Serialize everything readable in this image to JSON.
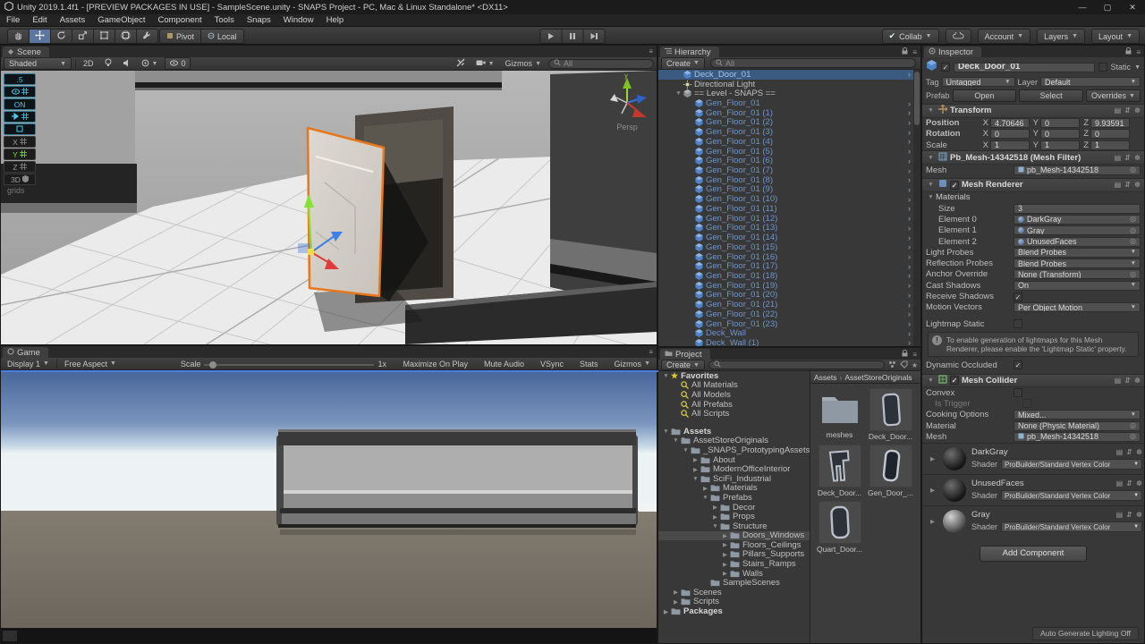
{
  "window": {
    "title": "Unity 2019.1.4f1 - [PREVIEW PACKAGES IN USE] - SampleScene.unity - SNAPS Project - PC, Mac & Linux Standalone* <DX11>",
    "menu_items": [
      "File",
      "Edit",
      "Assets",
      "GameObject",
      "Component",
      "Tools",
      "Snaps",
      "Window",
      "Help"
    ],
    "minimize": "—",
    "maximize": "▢",
    "close": "✕"
  },
  "toolbar": {
    "tools": [
      "hand-tool",
      "move-tool",
      "rotate-tool",
      "scale-tool",
      "rect-tool",
      "transform-tool",
      "custom-tool"
    ],
    "active_tool": "move-tool",
    "pivot_label": "Pivot",
    "local_label": "Local",
    "collab_label": "Collab",
    "account_label": "Account",
    "layers_label": "Layers",
    "layout_label": "Layout"
  },
  "scene_panel": {
    "tab": "Scene",
    "draw_mode": "Shaded",
    "mode_2d": "2D",
    "visibility_count": "0",
    "gizmos_label": "Gizmos",
    "search_placeholder": "All",
    "persp_label": "Persp",
    "progrids": {
      "snap_value": ".5",
      "on_label": "ON",
      "x": "X",
      "y": "Y",
      "z": "Z",
      "three_d": "3D",
      "grids_label": "grids"
    }
  },
  "game_panel": {
    "tab": "Game",
    "display": "Display 1",
    "aspect": "Free Aspect",
    "scale_label": "Scale",
    "scale_value": "1x",
    "right_labels": [
      "Maximize On Play",
      "Mute Audio",
      "VSync",
      "Stats",
      "Gizmos"
    ]
  },
  "hierarchy": {
    "tab": "Hierarchy",
    "create_label": "Create",
    "search_placeholder": "All",
    "items": [
      {
        "label": "Deck_Door_01",
        "icon": "cube",
        "indent": 1,
        "prefab": true,
        "arrow": true,
        "selected": true
      },
      {
        "label": "Directional Light",
        "icon": "light",
        "indent": 1
      },
      {
        "label": "== Level - SNAPS ==",
        "icon": "cube-gray",
        "indent": 1,
        "expanded": true
      },
      {
        "label": "Gen_Floor_01",
        "icon": "cube",
        "indent": 2,
        "prefab": true,
        "arrow": true
      },
      {
        "label": "Gen_Floor_01 (1)",
        "icon": "cube",
        "indent": 2,
        "prefab": true,
        "arrow": true
      },
      {
        "label": "Gen_Floor_01 (2)",
        "icon": "cube",
        "indent": 2,
        "prefab": true,
        "arrow": true
      },
      {
        "label": "Gen_Floor_01 (3)",
        "icon": "cube",
        "indent": 2,
        "prefab": true,
        "arrow": true
      },
      {
        "label": "Gen_Floor_01 (4)",
        "icon": "cube",
        "indent": 2,
        "prefab": true,
        "arrow": true
      },
      {
        "label": "Gen_Floor_01 (5)",
        "icon": "cube",
        "indent": 2,
        "prefab": true,
        "arrow": true
      },
      {
        "label": "Gen_Floor_01 (6)",
        "icon": "cube",
        "indent": 2,
        "prefab": true,
        "arrow": true
      },
      {
        "label": "Gen_Floor_01 (7)",
        "icon": "cube",
        "indent": 2,
        "prefab": true,
        "arrow": true
      },
      {
        "label": "Gen_Floor_01 (8)",
        "icon": "cube",
        "indent": 2,
        "prefab": true,
        "arrow": true
      },
      {
        "label": "Gen_Floor_01 (9)",
        "icon": "cube",
        "indent": 2,
        "prefab": true,
        "arrow": true
      },
      {
        "label": "Gen_Floor_01 (10)",
        "icon": "cube",
        "indent": 2,
        "prefab": true,
        "arrow": true
      },
      {
        "label": "Gen_Floor_01 (11)",
        "icon": "cube",
        "indent": 2,
        "prefab": true,
        "arrow": true
      },
      {
        "label": "Gen_Floor_01 (12)",
        "icon": "cube",
        "indent": 2,
        "prefab": true,
        "arrow": true
      },
      {
        "label": "Gen_Floor_01 (13)",
        "icon": "cube",
        "indent": 2,
        "prefab": true,
        "arrow": true
      },
      {
        "label": "Gen_Floor_01 (14)",
        "icon": "cube",
        "indent": 2,
        "prefab": true,
        "arrow": true
      },
      {
        "label": "Gen_Floor_01 (15)",
        "icon": "cube",
        "indent": 2,
        "prefab": true,
        "arrow": true
      },
      {
        "label": "Gen_Floor_01 (16)",
        "icon": "cube",
        "indent": 2,
        "prefab": true,
        "arrow": true
      },
      {
        "label": "Gen_Floor_01 (17)",
        "icon": "cube",
        "indent": 2,
        "prefab": true,
        "arrow": true
      },
      {
        "label": "Gen_Floor_01 (18)",
        "icon": "cube",
        "indent": 2,
        "prefab": true,
        "arrow": true
      },
      {
        "label": "Gen_Floor_01 (19)",
        "icon": "cube",
        "indent": 2,
        "prefab": true,
        "arrow": true
      },
      {
        "label": "Gen_Floor_01 (20)",
        "icon": "cube",
        "indent": 2,
        "prefab": true,
        "arrow": true
      },
      {
        "label": "Gen_Floor_01 (21)",
        "icon": "cube",
        "indent": 2,
        "prefab": true,
        "arrow": true
      },
      {
        "label": "Gen_Floor_01 (22)",
        "icon": "cube",
        "indent": 2,
        "prefab": true,
        "arrow": true
      },
      {
        "label": "Gen_Floor_01 (23)",
        "icon": "cube",
        "indent": 2,
        "prefab": true,
        "arrow": true
      },
      {
        "label": "Deck_Wall",
        "icon": "cube",
        "indent": 2,
        "prefab": true,
        "arrow": true
      },
      {
        "label": "Deck_Wall (1)",
        "icon": "cube",
        "indent": 2,
        "prefab": true,
        "arrow": true
      }
    ]
  },
  "project": {
    "tab": "Project",
    "create_label": "Create",
    "favorites": [
      {
        "label": "Favorites",
        "indent": 0,
        "icon": "star",
        "expanded": true,
        "header": true
      },
      {
        "label": "All Materials",
        "indent": 1,
        "icon": "magstar"
      },
      {
        "label": "All Models",
        "indent": 1,
        "icon": "magstar"
      },
      {
        "label": "All Prefabs",
        "indent": 1,
        "icon": "magstar"
      },
      {
        "label": "All Scripts",
        "indent": 1,
        "icon": "magstar"
      }
    ],
    "tree": [
      {
        "label": "Assets",
        "indent": 0,
        "icon": "folder",
        "expanded": true,
        "header": true
      },
      {
        "label": "AssetStoreOriginals",
        "indent": 1,
        "icon": "folder",
        "expanded": true
      },
      {
        "label": "_SNAPS_PrototypingAssets",
        "indent": 2,
        "icon": "folder",
        "expanded": true
      },
      {
        "label": "About",
        "indent": 3,
        "icon": "folder",
        "collapsed": true
      },
      {
        "label": "ModernOfficeInterior",
        "indent": 3,
        "icon": "folder",
        "collapsed": true
      },
      {
        "label": "SciFi_Industrial",
        "indent": 3,
        "icon": "folder",
        "expanded": true
      },
      {
        "label": "Materials",
        "indent": 4,
        "icon": "folder",
        "collapsed": true
      },
      {
        "label": "Prefabs",
        "indent": 4,
        "icon": "folder",
        "expanded": true
      },
      {
        "label": "Decor",
        "indent": 5,
        "icon": "folder",
        "collapsed": true
      },
      {
        "label": "Props",
        "indent": 5,
        "icon": "folder",
        "collapsed": true
      },
      {
        "label": "Structure",
        "indent": 5,
        "icon": "folder",
        "expanded": true
      },
      {
        "label": "Doors_Windows",
        "indent": 6,
        "icon": "folder",
        "collapsed": true,
        "selected": true
      },
      {
        "label": "Floors_Ceilings",
        "indent": 6,
        "icon": "folder",
        "collapsed": true
      },
      {
        "label": "Pillars_Supports",
        "indent": 6,
        "icon": "folder",
        "collapsed": true
      },
      {
        "label": "Stairs_Ramps",
        "indent": 6,
        "icon": "folder",
        "collapsed": true
      },
      {
        "label": "Walls",
        "indent": 6,
        "icon": "folder",
        "collapsed": true
      },
      {
        "label": "SampleScenes",
        "indent": 4,
        "icon": "folder"
      },
      {
        "label": "Scenes",
        "indent": 1,
        "icon": "folder",
        "collapsed": true
      },
      {
        "label": "Scripts",
        "indent": 1,
        "icon": "folder",
        "collapsed": true
      },
      {
        "label": "Packages",
        "indent": 0,
        "icon": "folder",
        "collapsed": true,
        "header": true
      }
    ],
    "breadcrumb": [
      "Assets",
      "AssetStoreOriginals"
    ],
    "assets": [
      {
        "name": "meshes",
        "kind": "folder"
      },
      {
        "name": "Deck_Door...",
        "kind": "door"
      },
      {
        "name": "Deck_Door...",
        "kind": "frame"
      },
      {
        "name": "Gen_Door_...",
        "kind": "door2"
      },
      {
        "name": "Quart_Door...",
        "kind": "door3"
      }
    ]
  },
  "inspector": {
    "tab": "Inspector",
    "header": {
      "name": "Deck_Door_01",
      "static_label": "Static"
    },
    "tag_label": "Tag",
    "tag_value": "Untagged",
    "layer_label": "Layer",
    "layer_value": "Default",
    "prefab_label": "Prefab",
    "open_label": "Open",
    "select_label": "Select",
    "overrides_label": "Overrides",
    "transform": {
      "title": "Transform",
      "position_label": "Position",
      "rotation_label": "Rotation",
      "scale_label": "Scale",
      "position": {
        "x": "4.70646",
        "y": "0",
        "z": "9.93591"
      },
      "rotation": {
        "x": "0",
        "y": "0",
        "z": "0"
      },
      "scale": {
        "x": "1",
        "y": "1",
        "z": "1"
      }
    },
    "mesh_filter": {
      "title": "Pb_Mesh-14342518 (Mesh Filter)",
      "mesh_label": "Mesh",
      "mesh_value": "pb_Mesh-14342518"
    },
    "mesh_renderer": {
      "title": "Mesh Renderer",
      "materials_label": "Materials",
      "size_label": "Size",
      "size_value": "3",
      "elements": [
        {
          "label": "Element 0",
          "value": "DarkGray"
        },
        {
          "label": "Element 1",
          "value": "Gray"
        },
        {
          "label": "Element 2",
          "value": "UnusedFaces"
        }
      ],
      "rows": [
        {
          "label": "Light Probes",
          "value": "Blend Probes",
          "kind": "dropdown"
        },
        {
          "label": "Reflection Probes",
          "value": "Blend Probes",
          "kind": "dropdown"
        },
        {
          "label": "Anchor Override",
          "value": "None (Transform)",
          "kind": "object"
        },
        {
          "label": "Cast Shadows",
          "value": "On",
          "kind": "dropdown"
        },
        {
          "label": "Receive Shadows",
          "kind": "checkbox",
          "checked": true
        },
        {
          "label": "Motion Vectors",
          "value": "Per Object Motion",
          "kind": "dropdown"
        },
        {
          "label": "Lightmap Static",
          "kind": "checkbox",
          "checked": false
        }
      ],
      "info": "To enable generation of lightmaps for this Mesh Renderer, please enable the 'Lightmap Static' property.",
      "dynamic_occluded_label": "Dynamic Occluded"
    },
    "mesh_collider": {
      "title": "Mesh Collider",
      "convex_label": "Convex",
      "is_trigger_label": "Is Trigger",
      "cooking_label": "Cooking Options",
      "cooking_value": "Mixed...",
      "material_label": "Material",
      "material_value": "None (Physic Material)",
      "mesh_label": "Mesh",
      "mesh_value": "pb_Mesh-14342518"
    },
    "shader_label": "Shader",
    "materials": [
      {
        "name": "DarkGray",
        "shader": "ProBuilder/Standard Vertex Color",
        "tone": "dark"
      },
      {
        "name": "UnusedFaces",
        "shader": "ProBuilder/Standard Vertex Color",
        "tone": "dark"
      },
      {
        "name": "Gray",
        "shader": "ProBuilder/Standard Vertex Color",
        "tone": "light"
      }
    ],
    "add_component_label": "Add Component"
  },
  "status": {
    "lighting_button": "Auto Generate Lighting Off"
  },
  "colors": {
    "selection_outline": "#e8761a",
    "prefab_text": "#6e95cc",
    "hierarchy_selection": "#3a5a80",
    "sky_top": "#49679c",
    "ground": "#7b7569"
  }
}
